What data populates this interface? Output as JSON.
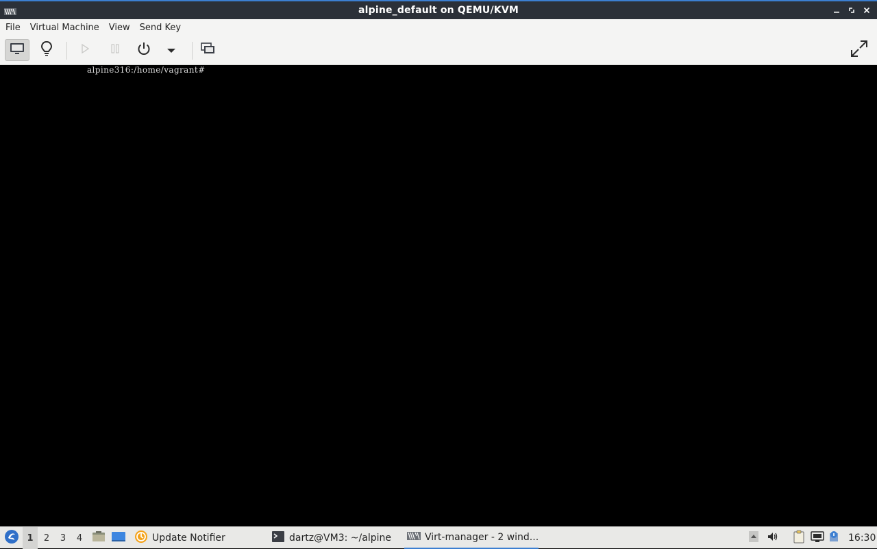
{
  "window": {
    "title": "alpine_default on QEMU/KVM"
  },
  "menubar": {
    "items": [
      "File",
      "Virtual Machine",
      "View",
      "Send Key"
    ]
  },
  "toolbar": {
    "buttons": [
      {
        "name": "console-view",
        "icon": "monitor-icon",
        "active": true
      },
      {
        "name": "details-view",
        "icon": "lightbulb-icon"
      },
      {
        "name": "run",
        "icon": "play-icon",
        "enabled": false
      },
      {
        "name": "pause",
        "icon": "pause-icon",
        "enabled": false
      },
      {
        "name": "shutdown",
        "icon": "power-icon"
      },
      {
        "name": "shutdown-menu",
        "icon": "chevron-down-icon"
      },
      {
        "name": "snapshots",
        "icon": "snapshots-icon"
      },
      {
        "name": "fullscreen",
        "icon": "fullscreen-icon"
      }
    ]
  },
  "console": {
    "prompt": "alpine316:/home/vagrant#"
  },
  "taskbar": {
    "workspaces": [
      "1",
      "2",
      "3",
      "4"
    ],
    "active_workspace": "1",
    "tasks": [
      {
        "label": "Update Notifier",
        "icon": "update-notifier-icon"
      },
      {
        "label": "dartz@VM3: ~/alpine",
        "icon": "terminal-icon"
      },
      {
        "label": "Virt-manager - 2 wind...",
        "icon": "virt-manager-icon",
        "active": true
      }
    ],
    "clock": "16:30"
  },
  "colors": {
    "accent": "#3c7fd1",
    "titlebar_bg": "#2b3038",
    "chrome_bg": "#f4f4f3",
    "console_bg": "#000000",
    "taskbar_bg": "#e9e9e7"
  }
}
